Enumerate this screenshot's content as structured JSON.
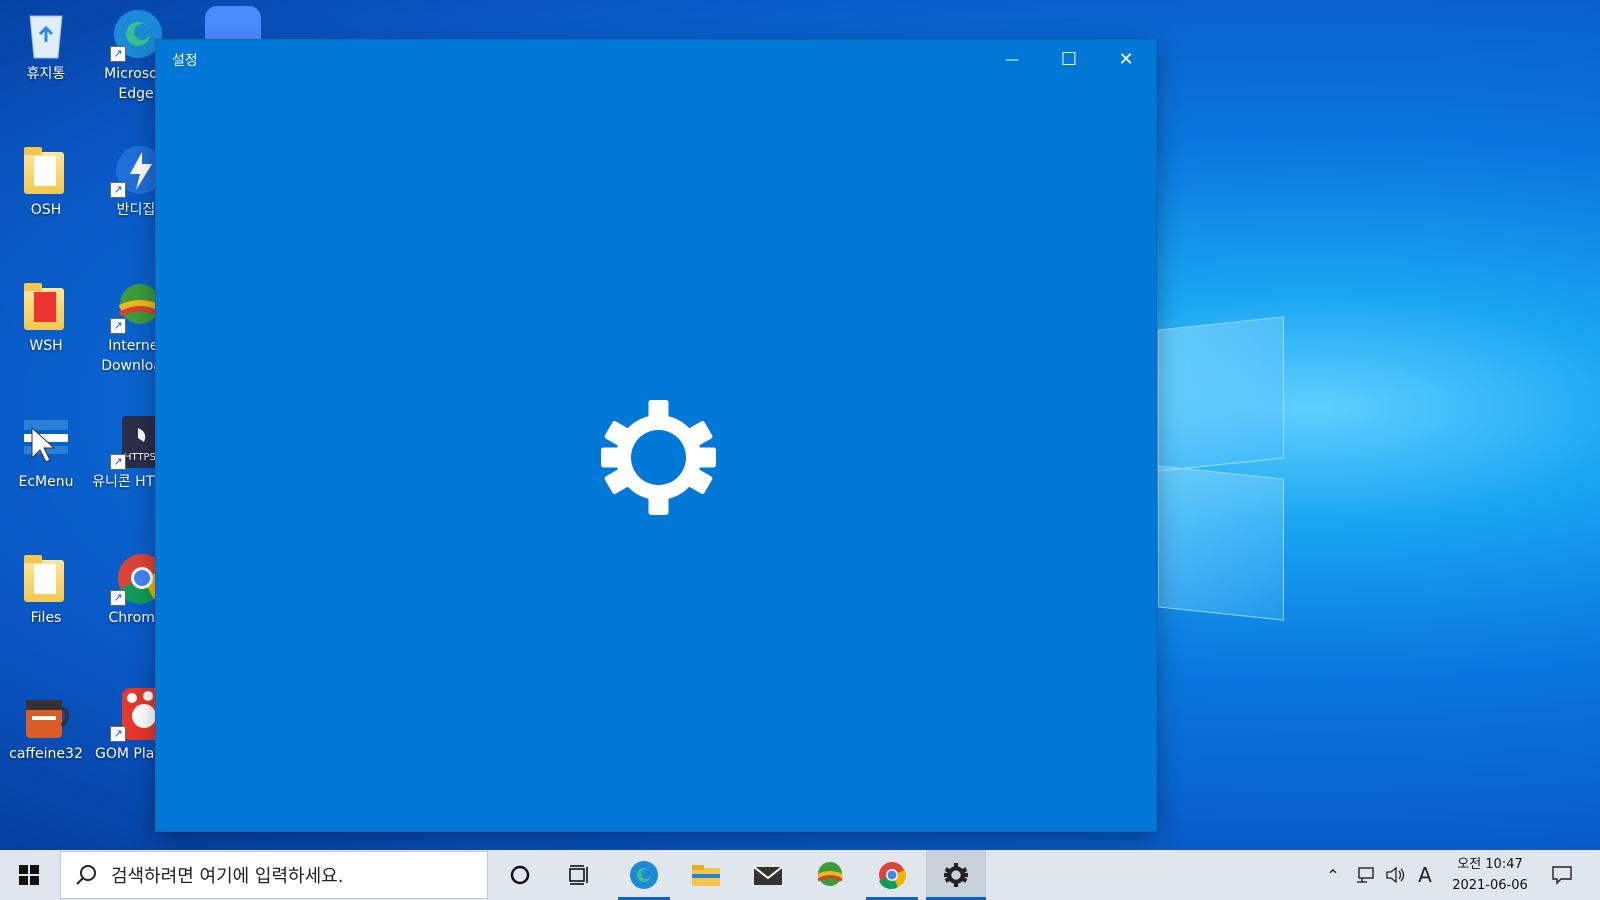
{
  "desktop": {
    "icons": [
      {
        "label": "휴지통"
      },
      {
        "label": "Microsoft Edge"
      },
      {
        "label": "OSH"
      },
      {
        "label": "반디집"
      },
      {
        "label": "WSH"
      },
      {
        "label": "Internet Download"
      },
      {
        "label": "EcMenu"
      },
      {
        "label": "유니콘 HTTPS"
      },
      {
        "label": "Files"
      },
      {
        "label": "Chrome"
      },
      {
        "label": "caffeine32"
      },
      {
        "label": "GOM Player"
      }
    ]
  },
  "window": {
    "title": "설정",
    "minimize": "—",
    "maximize": "☐",
    "close": "✕",
    "accent": "#0078d7"
  },
  "taskbar": {
    "search_placeholder": "검색하려면 여기에 입력하세요.",
    "tray": {
      "time": "오전 10:47",
      "date": "2021-06-06",
      "ime": "A"
    }
  }
}
